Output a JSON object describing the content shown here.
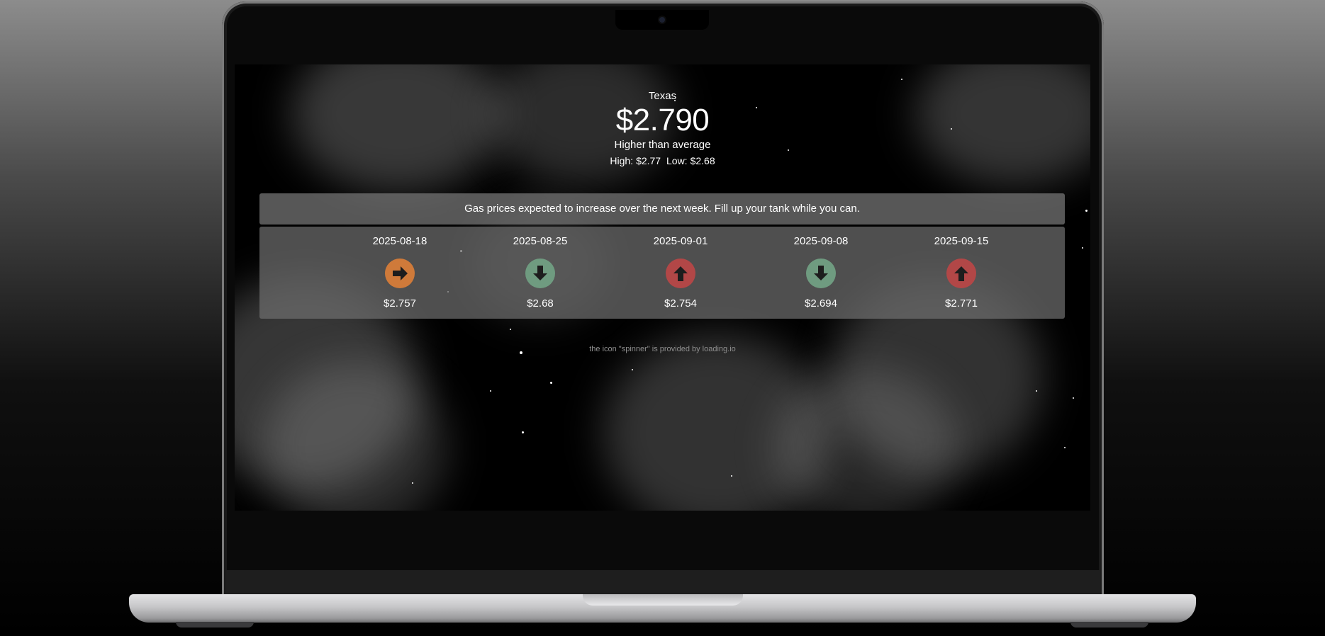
{
  "location": "Texas",
  "current_price": "$2.790",
  "average_note": "Higher than average",
  "high_label": "High:",
  "high_value": "$2.77",
  "low_label": "Low:",
  "low_value": "$2.68",
  "banner": "Gas prices expected to increase over the next week. Fill up your tank while you can.",
  "forecast": [
    {
      "date": "2025-08-18",
      "price": "$2.757",
      "trend": "right-arrow-icon",
      "color": "#cf7a3a"
    },
    {
      "date": "2025-08-25",
      "price": "$2.68",
      "trend": "down-arrow-icon",
      "color": "#6f9b80"
    },
    {
      "date": "2025-09-01",
      "price": "$2.754",
      "trend": "up-arrow-icon",
      "color": "#b24747"
    },
    {
      "date": "2025-09-08",
      "price": "$2.694",
      "trend": "down-arrow-icon",
      "color": "#6f9b80"
    },
    {
      "date": "2025-09-15",
      "price": "$2.771",
      "trend": "up-arrow-icon",
      "color": "#b24747"
    }
  ],
  "credit": {
    "prefix": "the icon \"spinner\" is provided by ",
    "link": "loading.io"
  }
}
